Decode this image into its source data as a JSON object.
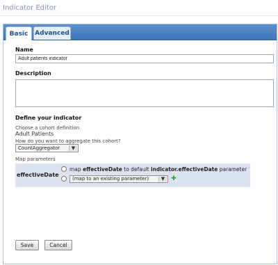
{
  "window": {
    "title": "Indicator Editor"
  },
  "tabs": [
    {
      "label": "Basic",
      "active": true
    },
    {
      "label": "Advanced",
      "active": false
    }
  ],
  "form": {
    "name_label": "Name",
    "name_value": "Adult patients indicator",
    "description_label": "Description",
    "description_value": "",
    "define_heading": "Define your indicator",
    "cohort_label": "Choose a cohort definition",
    "cohort_value": "Adult Patients",
    "aggregate_label": "How do you want to aggregate this cohort?",
    "aggregator_selected": "CountAggregator",
    "map_params_label": "Map parameters"
  },
  "mapping": {
    "param_name": "effectiveDate",
    "option1": {
      "prefix": "map",
      "param": "effectiveDate",
      "middle": "to default",
      "target": "indicator.effectiveDate",
      "suffix": "parameter"
    },
    "option2_selected": "(map to an existing parameter)"
  },
  "buttons": {
    "save": "Save",
    "cancel": "Cancel"
  },
  "colors": {
    "tab_bar": "#4a7fc1",
    "map_box_bg": "#dde2f1",
    "title_text": "#7f97b6"
  }
}
